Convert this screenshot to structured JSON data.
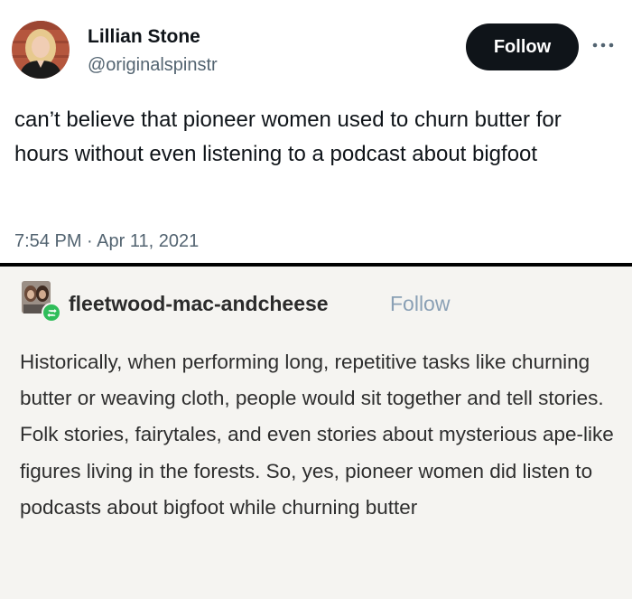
{
  "tweet": {
    "display_name": "Lillian Stone",
    "handle": "@originalspinstr",
    "follow_label": "Follow",
    "text": "can’t believe that pioneer women used to churn butter for hours without even listening to a podcast about bigfoot",
    "timestamp": "7:54 PM · Apr 11, 2021",
    "colors": {
      "text": "#0f1419",
      "muted": "#536471",
      "button_bg": "#0f1419"
    }
  },
  "tumblr": {
    "username": "fleetwood-mac-andcheese",
    "follow_label": "Follow",
    "body": "Historically, when performing long, repetitive tasks like churning butter or weaving cloth, people would sit together and tell stories. Folk stories, fairytales, and even stories about mysterious ape-like figures living in the forests. So, yes, pioneer women did listen to podcasts about bigfoot while churning butter",
    "reblog_icon": "reblog-icon",
    "colors": {
      "background": "#f5f4f1",
      "follow": "#8aa0b5",
      "reblog": "#2fbd5a"
    }
  }
}
